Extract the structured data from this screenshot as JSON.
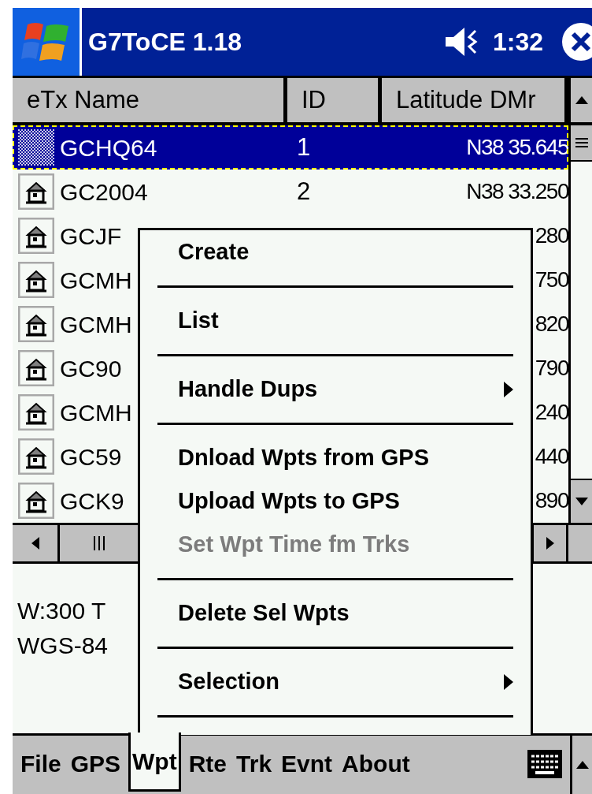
{
  "title_bar": {
    "title": "G7ToCE 1.18",
    "time": "1:32"
  },
  "table": {
    "columns": [
      "eTx Name",
      "ID",
      "Latitude DMr"
    ],
    "rows": [
      {
        "name": "GCHQ64",
        "id": "1",
        "latitude": "N38 35.645",
        "selected": true
      },
      {
        "name": "GC2004",
        "id": "2",
        "latitude": "N38 33.250",
        "selected": false
      },
      {
        "name": "GCJF",
        "latitude": "280",
        "selected": false
      },
      {
        "name": "GCMH",
        "latitude": "750",
        "selected": false
      },
      {
        "name": "GCMH",
        "latitude": "820",
        "selected": false
      },
      {
        "name": "GC90",
        "latitude": "790",
        "selected": false
      },
      {
        "name": "GCMH",
        "latitude": "240",
        "selected": false
      },
      {
        "name": "GC59",
        "latitude": "440",
        "selected": false
      },
      {
        "name": "GCK9",
        "latitude": "890",
        "selected": false
      }
    ]
  },
  "info_lines": [
    "W:300 T",
    "WGS-84"
  ],
  "menu": {
    "items": [
      {
        "kind": "item",
        "label": "Create",
        "disabled": false,
        "submenu": false
      },
      {
        "kind": "separator"
      },
      {
        "kind": "item",
        "label": "List",
        "disabled": false,
        "submenu": false
      },
      {
        "kind": "separator"
      },
      {
        "kind": "item",
        "label": "Handle Dups",
        "disabled": false,
        "submenu": true
      },
      {
        "kind": "separator"
      },
      {
        "kind": "item",
        "label": "Dnload Wpts from GPS",
        "disabled": false,
        "submenu": false
      },
      {
        "kind": "item",
        "label": "Upload Wpts to GPS",
        "disabled": false,
        "submenu": false
      },
      {
        "kind": "item",
        "label": "Set Wpt Time fm Trks",
        "disabled": true,
        "submenu": false
      },
      {
        "kind": "separator"
      },
      {
        "kind": "item",
        "label": "Delete Sel Wpts",
        "disabled": false,
        "submenu": false
      },
      {
        "kind": "separator"
      },
      {
        "kind": "item",
        "label": "Selection",
        "disabled": false,
        "submenu": true
      },
      {
        "kind": "separator"
      }
    ]
  },
  "menu_bar": {
    "items": [
      {
        "label": "File",
        "selected": false
      },
      {
        "label": "GPS",
        "selected": false
      },
      {
        "label": "Wpt",
        "selected": true
      },
      {
        "label": "Rte",
        "selected": false
      },
      {
        "label": "Trk",
        "selected": false
      },
      {
        "label": "Evnt",
        "selected": false
      },
      {
        "label": "About",
        "selected": false
      }
    ]
  }
}
